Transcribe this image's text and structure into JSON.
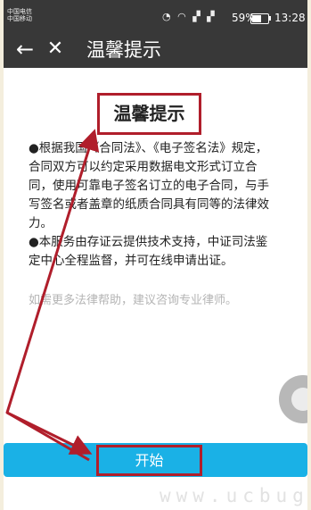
{
  "status_bar": {
    "carrier_line1": "中国电信",
    "carrier_line2": "中国移动",
    "icons": "◔ ◠ ▞ ▞",
    "battery_percent": "59%",
    "time": "13:28"
  },
  "app_bar": {
    "back_icon": "←",
    "close_icon": "✕",
    "title": "温馨提示"
  },
  "content": {
    "heading": "温馨提示",
    "paragraph1": "●根据我国《合同法》、《电子签名法》规定，合同双方可以约定采用数据电文形式订立合同，使用可靠电子签名订立的电子合同，与手写签名或者盖章的纸质合同具有同等的法律效力。",
    "paragraph2": "●本服务由存证云提供技术支持，中证司法鉴定中心全程监督，并可在线申请出证。",
    "hint": "如需更多法律帮助，建议咨询专业律师。"
  },
  "start_button": {
    "label": "开始"
  },
  "watermark": "www.ucbug.cc",
  "colors": {
    "app_bar": "#383838",
    "accent_button": "#1ab1e6",
    "annotation": "#b01e2b",
    "hint_text": "#b4b4b4"
  }
}
